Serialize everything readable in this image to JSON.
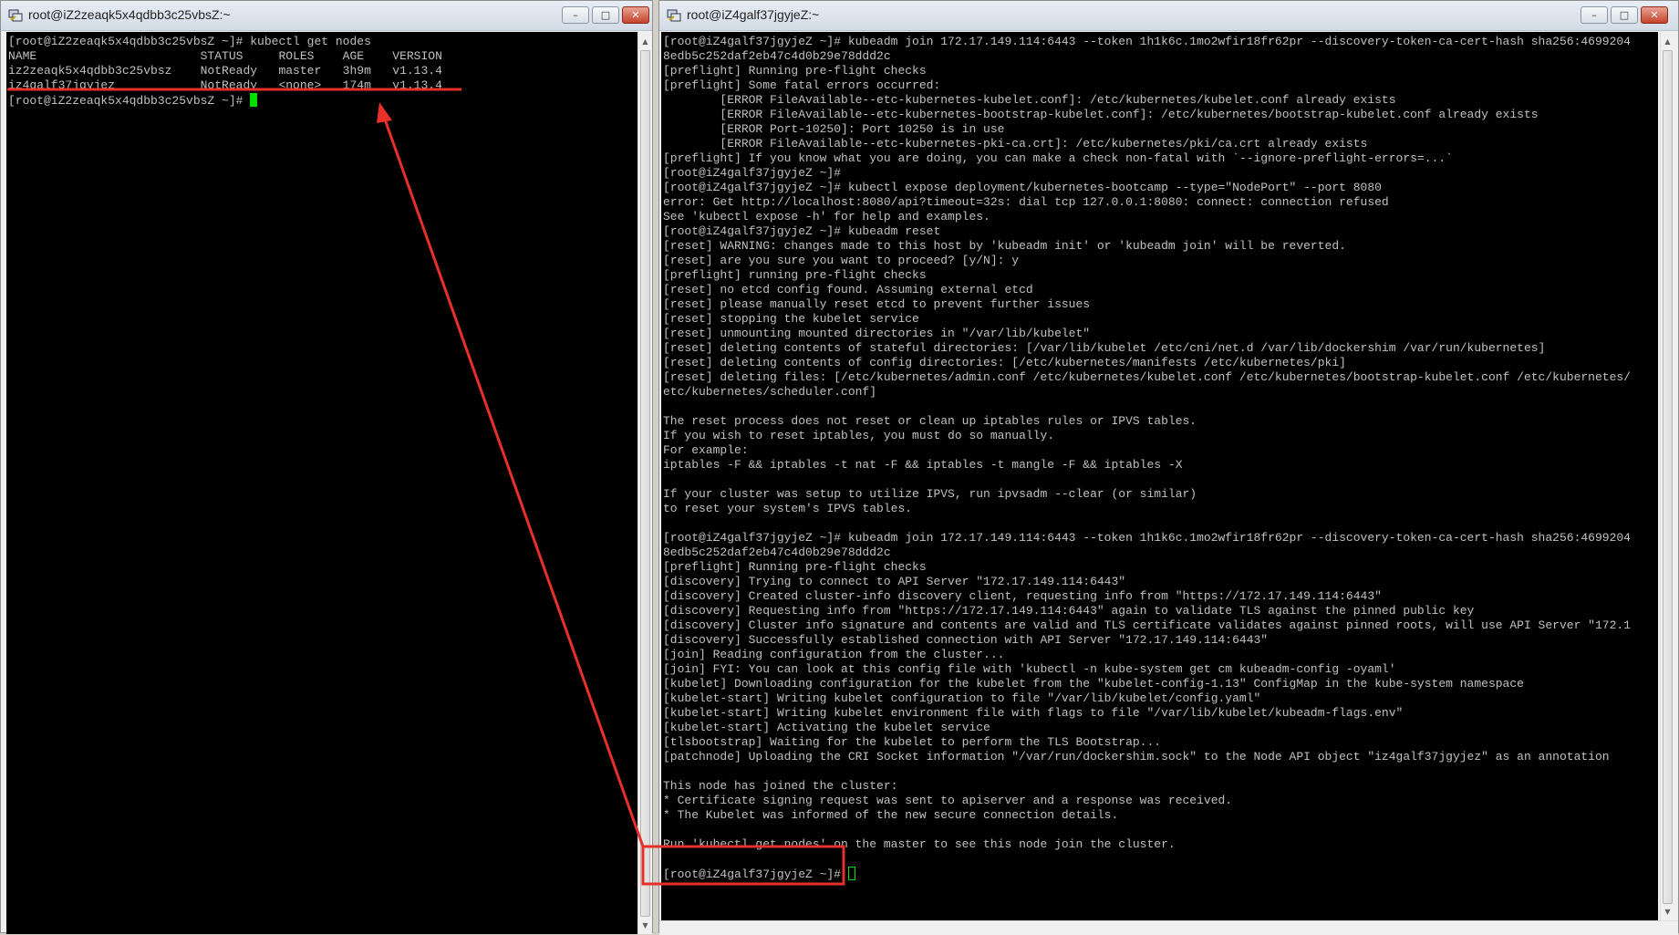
{
  "left_window": {
    "title": "root@iZ2zeaqk5x4qdbb3c25vbsZ:~",
    "controls": {
      "minimize": "–",
      "maximize": "□",
      "close": "✕"
    },
    "lines": [
      "[root@iZ2zeaqk5x4qdbb3c25vbsZ ~]# kubectl get nodes",
      "NAME                       STATUS     ROLES    AGE    VERSION",
      "iz2zeaqk5x4qdbb3c25vbsz    NotReady   master   3h9m   v1.13.4",
      "iz4galf37jgyjez            NotReady   <none>   174m   v1.13.4"
    ],
    "prompt": "[root@iZ2zeaqk5x4qdbb3c25vbsZ ~]# "
  },
  "right_window": {
    "title": "root@iZ4galf37jgyjeZ:~",
    "controls": {
      "minimize": "–",
      "maximize": "□",
      "close": "✕"
    },
    "lines": [
      "[root@iZ4galf37jgyjeZ ~]# kubeadm join 172.17.149.114:6443 --token 1h1k6c.1mo2wfir18fr62pr --discovery-token-ca-cert-hash sha256:4699204",
      "8edb5c252daf2eb47c4d0b29e78ddd2c",
      "[preflight] Running pre-flight checks",
      "[preflight] Some fatal errors occurred:",
      "        [ERROR FileAvailable--etc-kubernetes-kubelet.conf]: /etc/kubernetes/kubelet.conf already exists",
      "        [ERROR FileAvailable--etc-kubernetes-bootstrap-kubelet.conf]: /etc/kubernetes/bootstrap-kubelet.conf already exists",
      "        [ERROR Port-10250]: Port 10250 is in use",
      "        [ERROR FileAvailable--etc-kubernetes-pki-ca.crt]: /etc/kubernetes/pki/ca.crt already exists",
      "[preflight] If you know what you are doing, you can make a check non-fatal with `--ignore-preflight-errors=...`",
      "[root@iZ4galf37jgyjeZ ~]#",
      "[root@iZ4galf37jgyjeZ ~]# kubectl expose deployment/kubernetes-bootcamp --type=\"NodePort\" --port 8080",
      "error: Get http://localhost:8080/api?timeout=32s: dial tcp 127.0.0.1:8080: connect: connection refused",
      "See 'kubectl expose -h' for help and examples.",
      "[root@iZ4galf37jgyjeZ ~]# kubeadm reset",
      "[reset] WARNING: changes made to this host by 'kubeadm init' or 'kubeadm join' will be reverted.",
      "[reset] are you sure you want to proceed? [y/N]: y",
      "[preflight] running pre-flight checks",
      "[reset] no etcd config found. Assuming external etcd",
      "[reset] please manually reset etcd to prevent further issues",
      "[reset] stopping the kubelet service",
      "[reset] unmounting mounted directories in \"/var/lib/kubelet\"",
      "[reset] deleting contents of stateful directories: [/var/lib/kubelet /etc/cni/net.d /var/lib/dockershim /var/run/kubernetes]",
      "[reset] deleting contents of config directories: [/etc/kubernetes/manifests /etc/kubernetes/pki]",
      "[reset] deleting files: [/etc/kubernetes/admin.conf /etc/kubernetes/kubelet.conf /etc/kubernetes/bootstrap-kubelet.conf /etc/kubernetes/",
      "etc/kubernetes/scheduler.conf]",
      "",
      "The reset process does not reset or clean up iptables rules or IPVS tables.",
      "If you wish to reset iptables, you must do so manually.",
      "For example:",
      "iptables -F && iptables -t nat -F && iptables -t mangle -F && iptables -X",
      "",
      "If your cluster was setup to utilize IPVS, run ipvsadm --clear (or similar)",
      "to reset your system's IPVS tables.",
      "",
      "[root@iZ4galf37jgyjeZ ~]# kubeadm join 172.17.149.114:6443 --token 1h1k6c.1mo2wfir18fr62pr --discovery-token-ca-cert-hash sha256:4699204",
      "8edb5c252daf2eb47c4d0b29e78ddd2c",
      "[preflight] Running pre-flight checks",
      "[discovery] Trying to connect to API Server \"172.17.149.114:6443\"",
      "[discovery] Created cluster-info discovery client, requesting info from \"https://172.17.149.114:6443\"",
      "[discovery] Requesting info from \"https://172.17.149.114:6443\" again to validate TLS against the pinned public key",
      "[discovery] Cluster info signature and contents are valid and TLS certificate validates against pinned roots, will use API Server \"172.1",
      "[discovery] Successfully established connection with API Server \"172.17.149.114:6443\"",
      "[join] Reading configuration from the cluster...",
      "[join] FYI: You can look at this config file with 'kubectl -n kube-system get cm kubeadm-config -oyaml'",
      "[kubelet] Downloading configuration for the kubelet from the \"kubelet-config-1.13\" ConfigMap in the kube-system namespace",
      "[kubelet-start] Writing kubelet configuration to file \"/var/lib/kubelet/config.yaml\"",
      "[kubelet-start] Writing kubelet environment file with flags to file \"/var/lib/kubelet/kubeadm-flags.env\"",
      "[kubelet-start] Activating the kubelet service",
      "[tlsbootstrap] Waiting for the kubelet to perform the TLS Bootstrap...",
      "[patchnode] Uploading the CRI Socket information \"/var/run/dockershim.sock\" to the Node API object \"iz4galf37jgyjez\" as an annotation",
      "",
      "This node has joined the cluster:",
      "* Certificate signing request was sent to apiserver and a response was received.",
      "* The Kubelet was informed of the new secure connection details.",
      "",
      "Run 'kubectl get nodes' on the master to see this node join the cluster.",
      ""
    ],
    "prompt": "[root@iZ4galf37jgyjeZ ~]# "
  },
  "annotation_color": "#e8302a",
  "terminal_colors": {
    "background": "#000000",
    "text": "#c0c0c0",
    "cursor": "#00e000"
  }
}
